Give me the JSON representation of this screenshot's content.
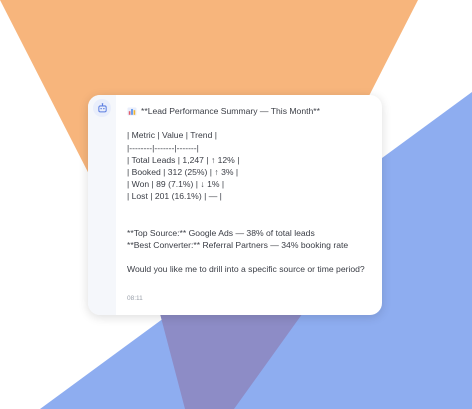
{
  "message": {
    "title": "**Lead Performance Summary — This Month**",
    "table_lines": [
      "| Metric | Value | Trend |",
      "|--------|-------|-------|",
      "| Total Leads | 1,247 | ↑ 12% |",
      "| Booked | 312 (25%) | ↑ 3% |",
      "| Won | 89 (7.1%) | ↓ 1% |",
      "| Lost | 201 (16.1%) | — |"
    ],
    "top_source": "**Top Source:** Google Ads — 38% of total leads",
    "best_converter": "**Best Converter:** Referral Partners — 34% booking rate",
    "question": "Would you like me to drill into a specific source or time period?",
    "time": "08:11"
  },
  "icons": {
    "avatar": "robot-icon",
    "title": "bar-chart-icon"
  },
  "colors": {
    "orange": "#f7b57c",
    "blue": "#8eadf0",
    "purple": "#8d8cc6",
    "avatar_bg": "#e9eefb",
    "avatar_fg": "#5b7de0"
  }
}
